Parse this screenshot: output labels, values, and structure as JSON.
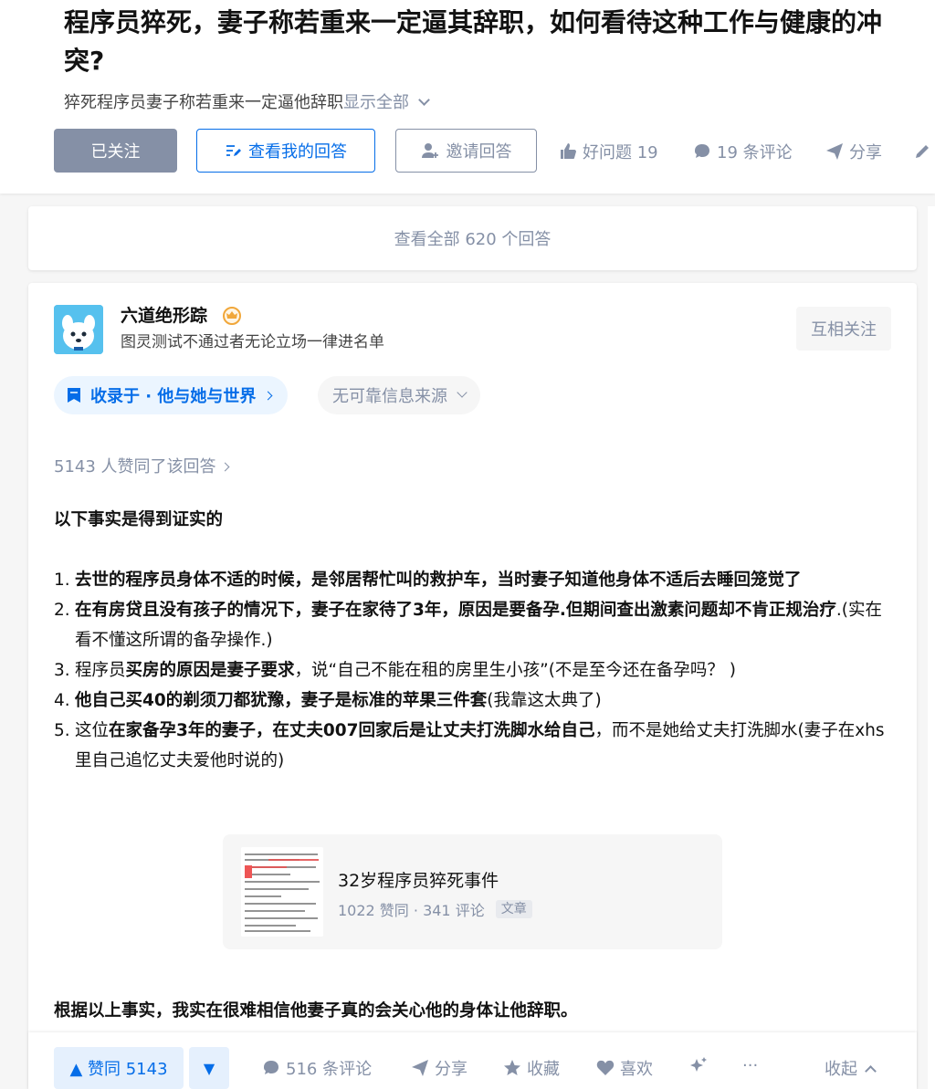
{
  "question": {
    "title": "程序员猝死，妻子称若重来一定逼其辞职，如何看待这种工作与健康的冲突?",
    "description": "猝死程序员妻子称若重来一定逼他辞职",
    "show_all": "显示全部"
  },
  "actions": {
    "followed": "已关注",
    "my_answer": "查看我的回答",
    "invite": "邀请回答",
    "good_question": "好问题 19",
    "comments": "19 条评论",
    "share": "分享"
  },
  "view_all": "查看全部 620 个回答",
  "answer": {
    "author": {
      "name": "六道绝形踪",
      "bio": "图灵测试不通过者无论立场一律进名单",
      "mutual_follow": "互相关注"
    },
    "collected_in": "收录于 · 他与她与世界",
    "source_tag": "无可靠信息来源",
    "voters": "5143 人赞同了该回答",
    "lead": "以下事实是得到证实的",
    "items": [
      {
        "num": "1.",
        "bold": "去世的程序员身体不适的时候，是邻居帮忙叫的救护车，当时妻子知道他身体不适后去睡回笼觉了",
        "normal": ""
      },
      {
        "num": "2.",
        "bold": "在有房贷且没有孩子的情况下，妻子在家待了3年，原因是要备孕.但期间查出激素问题却不肯正规治疗",
        "normal": ".(实在看不懂这所谓的备孕操作.)"
      },
      {
        "num": "3.",
        "pre": "程序员",
        "bold": "买房的原因是妻子要求",
        "normal": "，说“自己不能在租的房里生小孩”(不是至今还在备孕吗？ )"
      },
      {
        "num": "4.",
        "bold": "他自己买40的剃须刀都犹豫，妻子是标准的苹果三件套",
        "normal": "(我靠这太典了)"
      },
      {
        "num": "5.",
        "pre": "这位",
        "bold": "在家备孕3年的妻子，在丈夫007回家后是让丈夫打洗脚水给自己",
        "normal": "，而不是她给丈夫打洗脚水(妻子在xhs里自己追忆丈夫爱他时说的)"
      }
    ],
    "link_card": {
      "title": "32岁程序员猝死事件",
      "meta": "1022 赞同 · 341 评论",
      "kind": "文章"
    },
    "conclusion": "根据以上事实，我实在很难相信他妻子真的会关心他的身体让他辞职。"
  },
  "bottom_bar": {
    "vote_up": "▲ 赞同 5143",
    "vote_down": "▼",
    "comments": "516 条评论",
    "share": "分享",
    "collect": "收藏",
    "like": "喜欢",
    "more": "···",
    "collapse": "收起"
  },
  "colors": {
    "accent": "#056de8",
    "muted": "#8590a6",
    "followed_bg": "#8590a6"
  }
}
